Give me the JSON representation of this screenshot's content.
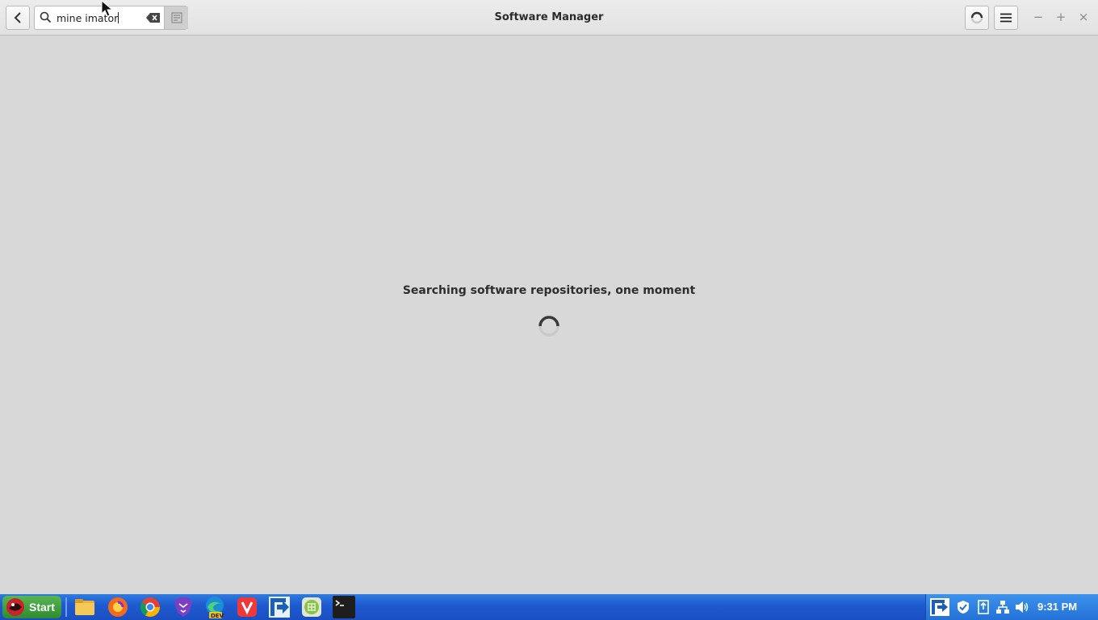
{
  "window": {
    "title": "Software Manager"
  },
  "search": {
    "value": "mine imator"
  },
  "main": {
    "status_message": "Searching software repositories, one moment"
  },
  "titlebar_buttons": {
    "minimize": "−",
    "maximize": "+",
    "close": "×"
  },
  "taskbar": {
    "start_label": "Start",
    "pinned": [
      "files-icon",
      "firefox-icon",
      "chrome-icon",
      "brave-icon",
      "edge-dev-icon",
      "vivaldi-icon",
      "freefilesync-icon",
      "app-grid-icon",
      "terminal-icon"
    ],
    "edge_badge": "DEV",
    "clock": "9:31 PM"
  },
  "colors": {
    "taskbar": "#1f5bd0",
    "start": "#3a9a36",
    "background": "#d8d8d8"
  }
}
